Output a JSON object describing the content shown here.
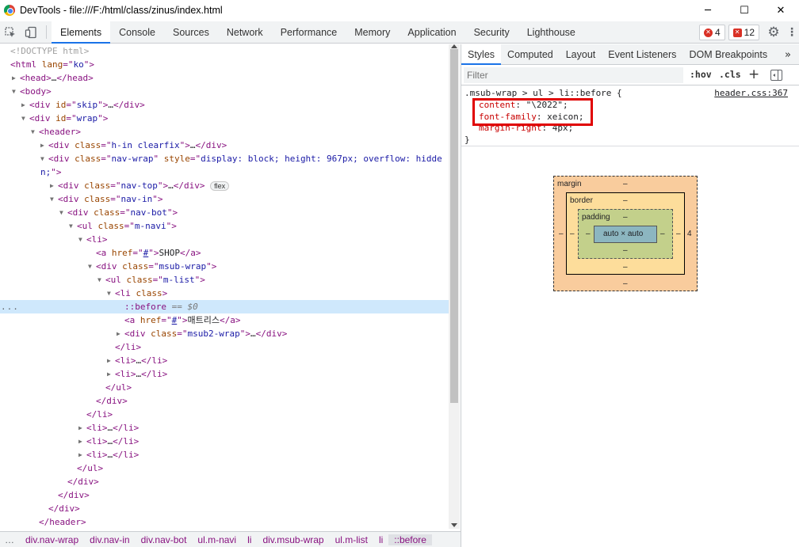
{
  "window": {
    "title": "DevTools - file:///F:/html/class/zinus/index.html",
    "controls": [
      "─",
      "☐",
      "✕"
    ]
  },
  "toolbar": {
    "tabs": [
      "Elements",
      "Console",
      "Sources",
      "Network",
      "Performance",
      "Memory",
      "Application",
      "Security",
      "Lighthouse"
    ],
    "active_tab": "Elements",
    "errors_count": "4",
    "issues_count": "12"
  },
  "elements": {
    "lines": [
      {
        "i": 0,
        "t": null,
        "h": "<span class='c-dt'>&lt;!DOCTYPE html&gt;</span>"
      },
      {
        "i": 0,
        "t": null,
        "h": "<span class='c-tag'>&lt;html</span> <span class='c-an'>lang</span><span class='c-tag'>=\"</span><span class='c-av'>ko</span><span class='c-tag'>\"&gt;</span>"
      },
      {
        "i": 1,
        "t": "c",
        "h": "<span class='c-tag'>&lt;head&gt;</span><span class='c-ell'>…</span><span class='c-tag'>&lt;/head&gt;</span>"
      },
      {
        "i": 1,
        "t": "e",
        "h": "<span class='c-tag'>&lt;body&gt;</span>"
      },
      {
        "i": 2,
        "t": "c",
        "h": "<span class='c-tag'>&lt;div</span> <span class='c-an'>id</span><span class='c-tag'>=\"</span><span class='c-av'>skip</span><span class='c-tag'>\"&gt;</span><span class='c-ell'>…</span><span class='c-tag'>&lt;/div&gt;</span>"
      },
      {
        "i": 2,
        "t": "e",
        "h": "<span class='c-tag'>&lt;div</span> <span class='c-an'>id</span><span class='c-tag'>=\"</span><span class='c-av'>wrap</span><span class='c-tag'>\"&gt;</span>"
      },
      {
        "i": 3,
        "t": "e",
        "h": "<span class='c-tag'>&lt;header&gt;</span>"
      },
      {
        "i": 4,
        "t": "c",
        "h": "<span class='c-tag'>&lt;div</span> <span class='c-an'>class</span><span class='c-tag'>=\"</span><span class='c-av'>h-in clearfix</span><span class='c-tag'>\"&gt;</span><span class='c-ell'>…</span><span class='c-tag'>&lt;/div&gt;</span>"
      },
      {
        "i": 4,
        "t": "e",
        "h": "<span class='c-tag'>&lt;div</span> <span class='c-an'>class</span><span class='c-tag'>=\"</span><span class='c-av'>nav-wrap</span><span class='c-tag'>\"</span> <span class='c-an'>style</span><span class='c-tag'>=\"</span><span class='c-av'>display: block; height: 967px; overflow: hidde</span>"
      },
      {
        "i": -1,
        "t": null,
        "h": "<span class='c-av'>n;</span><span class='c-tag'>\"&gt;</span>"
      },
      {
        "i": 5,
        "t": "c",
        "h": "<span class='c-tag'>&lt;div</span> <span class='c-an'>class</span><span class='c-tag'>=\"</span><span class='c-av'>nav-top</span><span class='c-tag'>\"&gt;</span><span class='c-ell'>…</span><span class='c-tag'>&lt;/div&gt;</span> <span class='flexbadge'>flex</span>"
      },
      {
        "i": 5,
        "t": "e",
        "h": "<span class='c-tag'>&lt;div</span> <span class='c-an'>class</span><span class='c-tag'>=\"</span><span class='c-av'>nav-in</span><span class='c-tag'>\"&gt;</span>"
      },
      {
        "i": 6,
        "t": "e",
        "h": "<span class='c-tag'>&lt;div</span> <span class='c-an'>class</span><span class='c-tag'>=\"</span><span class='c-av'>nav-bot</span><span class='c-tag'>\"&gt;</span>"
      },
      {
        "i": 7,
        "t": "e",
        "h": "<span class='c-tag'>&lt;ul</span> <span class='c-an'>class</span><span class='c-tag'>=\"</span><span class='c-av'>m-navi</span><span class='c-tag'>\"&gt;</span>"
      },
      {
        "i": 8,
        "t": "e",
        "h": "<span class='c-tag'>&lt;li&gt;</span>"
      },
      {
        "i": 9,
        "t": null,
        "h": "<span class='c-tag'>&lt;a</span> <span class='c-an'>href</span><span class='c-tag'>=\"</span><span class='c-link'>#</span><span class='c-tag'>\"&gt;</span><span class='c-txt'>SHOP</span><span class='c-tag'>&lt;/a&gt;</span>"
      },
      {
        "i": 9,
        "t": "e",
        "h": "<span class='c-tag'>&lt;div</span> <span class='c-an'>class</span><span class='c-tag'>=\"</span><span class='c-av'>msub-wrap</span><span class='c-tag'>\"&gt;</span>"
      },
      {
        "i": 10,
        "t": "e",
        "h": "<span class='c-tag'>&lt;ul</span> <span class='c-an'>class</span><span class='c-tag'>=\"</span><span class='c-av'>m-list</span><span class='c-tag'>\"&gt;</span>"
      },
      {
        "i": 11,
        "t": "e",
        "h": "<span class='c-tag'>&lt;li</span> <span class='c-an'>class</span><span class='c-tag'>&gt;</span>"
      },
      {
        "i": 12,
        "t": null,
        "sel": true,
        "h": "<span class='c-pseudo'>::before</span> <span class='c-dollar'>== $0</span>"
      },
      {
        "i": 12,
        "t": null,
        "h": "<span class='c-tag'>&lt;a</span> <span class='c-an'>href</span><span class='c-tag'>=\"</span><span class='c-link'>#</span><span class='c-tag'>\"&gt;</span><span class='c-txt'>매트리스</span><span class='c-tag'>&lt;/a&gt;</span>"
      },
      {
        "i": 12,
        "t": "c",
        "h": "<span class='c-tag'>&lt;div</span> <span class='c-an'>class</span><span class='c-tag'>=\"</span><span class='c-av'>msub2-wrap</span><span class='c-tag'>\"&gt;</span><span class='c-ell'>…</span><span class='c-tag'>&lt;/div&gt;</span>"
      },
      {
        "i": 11,
        "t": null,
        "h": "<span class='c-tag'>&lt;/li&gt;</span>"
      },
      {
        "i": 11,
        "t": "c",
        "h": "<span class='c-tag'>&lt;li&gt;</span><span class='c-ell'>…</span><span class='c-tag'>&lt;/li&gt;</span>"
      },
      {
        "i": 11,
        "t": "c",
        "h": "<span class='c-tag'>&lt;li&gt;</span><span class='c-ell'>…</span><span class='c-tag'>&lt;/li&gt;</span>"
      },
      {
        "i": 10,
        "t": null,
        "h": "<span class='c-tag'>&lt;/ul&gt;</span>"
      },
      {
        "i": 9,
        "t": null,
        "h": "<span class='c-tag'>&lt;/div&gt;</span>"
      },
      {
        "i": 8,
        "t": null,
        "h": "<span class='c-tag'>&lt;/li&gt;</span>"
      },
      {
        "i": 8,
        "t": "c",
        "h": "<span class='c-tag'>&lt;li&gt;</span><span class='c-ell'>…</span><span class='c-tag'>&lt;/li&gt;</span>"
      },
      {
        "i": 8,
        "t": "c",
        "h": "<span class='c-tag'>&lt;li&gt;</span><span class='c-ell'>…</span><span class='c-tag'>&lt;/li&gt;</span>"
      },
      {
        "i": 8,
        "t": "c",
        "h": "<span class='c-tag'>&lt;li&gt;</span><span class='c-ell'>…</span><span class='c-tag'>&lt;/li&gt;</span>"
      },
      {
        "i": 7,
        "t": null,
        "h": "<span class='c-tag'>&lt;/ul&gt;</span>"
      },
      {
        "i": 6,
        "t": null,
        "h": "<span class='c-tag'>&lt;/div&gt;</span>"
      },
      {
        "i": 5,
        "t": null,
        "h": "<span class='c-tag'>&lt;/div&gt;</span>"
      },
      {
        "i": 4,
        "t": null,
        "h": "<span class='c-tag'>&lt;/div&gt;</span>"
      },
      {
        "i": 3,
        "t": null,
        "h": "<span class='c-tag'>&lt;/header&gt;</span>"
      }
    ],
    "gutter_dots": "..."
  },
  "breadcrumbs": [
    "…",
    "div.nav-wrap",
    "div.nav-in",
    "div.nav-bot",
    "ul.m-navi",
    "li",
    "div.msub-wrap",
    "ul.m-list",
    "li",
    "::before"
  ],
  "styles": {
    "tabs": [
      "Styles",
      "Computed",
      "Layout",
      "Event Listeners",
      "DOM Breakpoints"
    ],
    "active_tab": "Styles",
    "more": "»",
    "filter_placeholder": "Filter",
    "hov": ":hov",
    "cls": ".cls",
    "plus": "+",
    "rule": {
      "selector": ".msub-wrap > ul > li::before {",
      "source": "header.css:367",
      "decls": [
        {
          "name": "content",
          "value": "\"\\2022\";"
        },
        {
          "name": "font-family",
          "value": "xeicon;"
        },
        {
          "name": "margin-right",
          "value": "4px;"
        }
      ],
      "close": "}"
    }
  },
  "boxmodel": {
    "margin_label": "margin",
    "border_label": "border",
    "padding_label": "padding",
    "content": "auto × auto",
    "margin_top": "–",
    "margin_bottom": "–",
    "margin_left": "–",
    "margin_right": "4",
    "border_top": "–",
    "border_bottom": "–",
    "border_left": "–",
    "border_right": "–",
    "padding_top": "–",
    "padding_bottom": "–",
    "padding_left": "–",
    "padding_right": "–"
  }
}
